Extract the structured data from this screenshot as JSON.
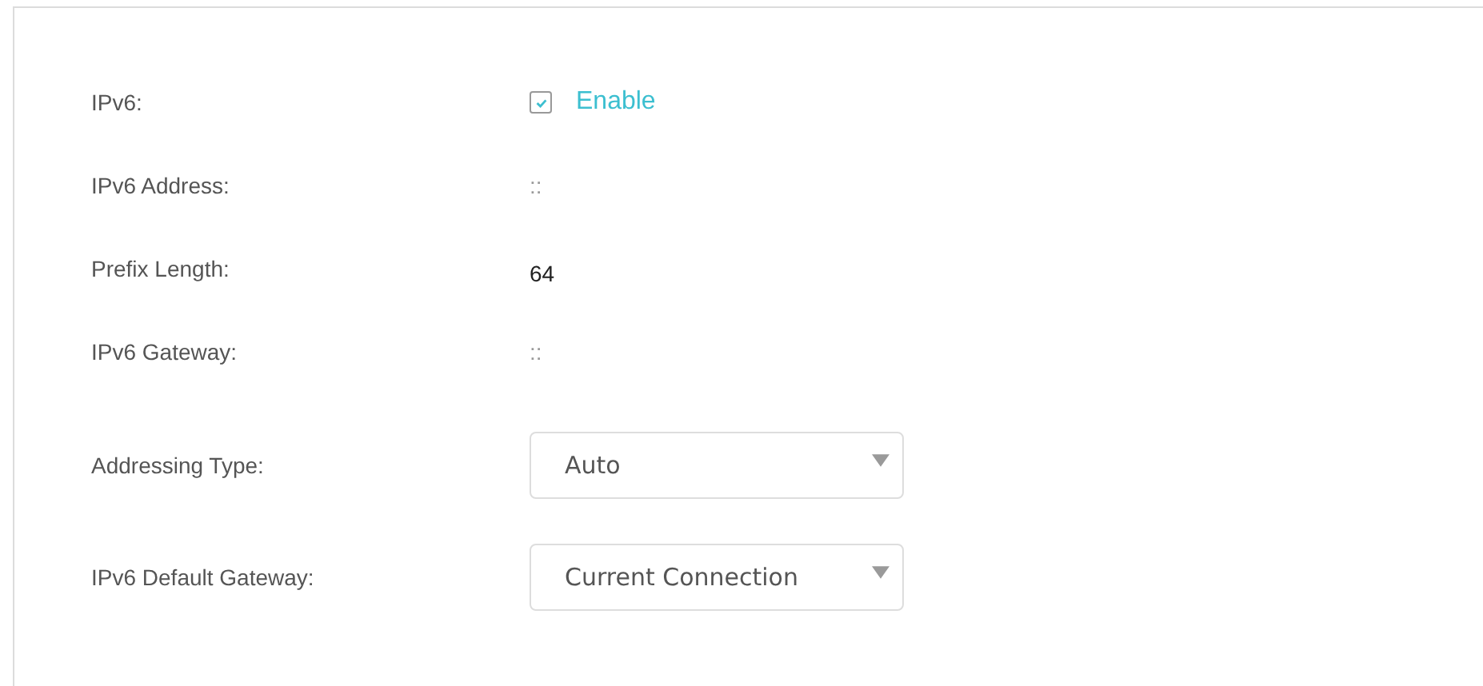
{
  "fields": [
    {
      "kind": "checkbox",
      "label": "IPv6:",
      "value": "Enable",
      "checked": true
    },
    {
      "kind": "static",
      "label": "IPv6 Address:",
      "value": "::"
    },
    {
      "kind": "text",
      "label": "Prefix Length:",
      "value": "64"
    },
    {
      "kind": "static",
      "label": "IPv6 Gateway:",
      "value": "::"
    },
    {
      "kind": "dropdown",
      "label": "Addressing Type:",
      "value": "Auto"
    },
    {
      "kind": "dropdown",
      "label": "IPv6 Default Gateway:",
      "value": "Current Connection"
    }
  ]
}
